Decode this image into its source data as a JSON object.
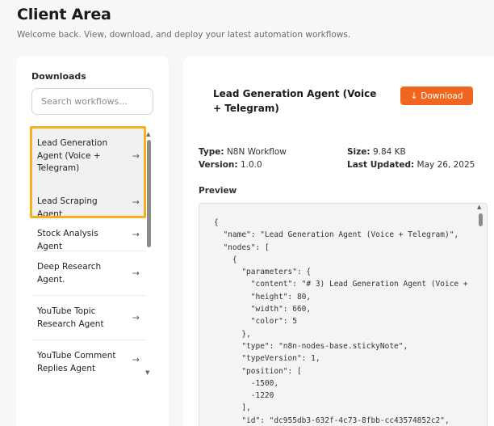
{
  "page": {
    "title": "Client Area",
    "subtitle": "Welcome back. View, download, and deploy your latest automation workflows."
  },
  "sidebar": {
    "heading": "Downloads",
    "search_placeholder": "Search workflows...",
    "items": [
      {
        "label": "Lead Generation Agent (Voice + Telegram)",
        "arrow": "→",
        "active": true
      },
      {
        "label": "Lead Scraping Agent",
        "arrow": "→",
        "active": false
      },
      {
        "label": "Stock Analysis Agent",
        "arrow": "→",
        "active": false
      },
      {
        "label": "Deep Research Agent.",
        "arrow": "→",
        "active": false
      },
      {
        "label": "YouTube Topic Research Agent",
        "arrow": "→",
        "active": false
      },
      {
        "label": "YouTube Comment Replies Agent",
        "arrow": "→",
        "active": false
      }
    ]
  },
  "detail": {
    "title": "Lead Generation Agent (Voice + Telegram)",
    "download_icon": "↓",
    "download_label": "Download",
    "type_label": "Type:",
    "type_value": "N8N Workflow",
    "version_label": "Version:",
    "version_value": "1.0.0",
    "size_label": "Size:",
    "size_value": "9.84 KB",
    "updated_label": "Last Updated:",
    "updated_value": "May 26, 2025",
    "preview_label": "Preview",
    "code": "{\n  \"name\": \"Lead Generation Agent (Voice + Telegram)\",\n  \"nodes\": [\n    {\n      \"parameters\": {\n        \"content\": \"# 3) Lead Generation Agent (Voice +\n        \"height\": 80,\n        \"width\": 660,\n        \"color\": 5\n      },\n      \"type\": \"n8n-nodes-base.stickyNote\",\n      \"typeVersion\": 1,\n      \"position\": [\n        -1500,\n        -1220\n      ],\n      \"id\": \"dc955db3-632f-4c73-8fbb-cc43574852c2\","
  },
  "colors": {
    "accent": "#f0661f",
    "highlight": "#f2b21c"
  }
}
